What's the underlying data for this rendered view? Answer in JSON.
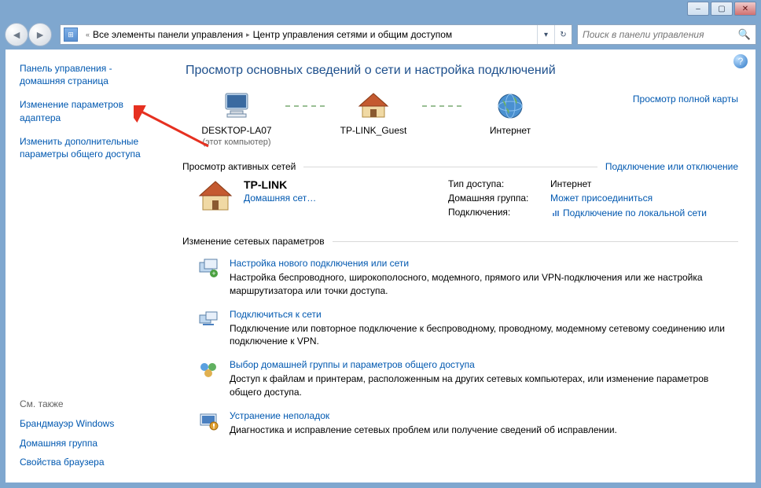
{
  "titlebar": {
    "minimize": "–",
    "maximize": "▢",
    "close": "✕"
  },
  "address": {
    "parent": "Все элементы панели управления",
    "current": "Центр управления сетями и общим доступом",
    "nav_back": "◄",
    "nav_fwd": "►",
    "refresh": "↻",
    "dropdown": "▾"
  },
  "search": {
    "placeholder": "Поиск в панели управления"
  },
  "sidebar": {
    "home": "Панель управления - домашняя страница",
    "adapter": "Изменение параметров адаптера",
    "sharing": "Изменить дополнительные параметры общего доступа",
    "see_also_label": "См. также",
    "links": {
      "firewall": "Брандмауэр Windows",
      "homegroup": "Домашняя группа",
      "browser": "Свойства браузера"
    }
  },
  "main": {
    "title": "Просмотр основных сведений о сети и настройка подключений",
    "map": {
      "view_map": "Просмотр полной карты",
      "computer_name": "DESKTOP-LA07",
      "computer_sub": "(этот компьютер)",
      "router_name": "TP-LINK_Guest",
      "internet_name": "Интернет"
    },
    "active_header": "Просмотр активных сетей",
    "active_link": "Подключение или отключение",
    "network": {
      "name": "TP-LINK",
      "type": "Домашняя сет…",
      "access_k": "Тип доступа:",
      "access_v": "Интернет",
      "homegroup_k": "Домашняя группа:",
      "homegroup_v": "Может присоединиться",
      "conn_k": "Подключения:",
      "conn_v": "Подключение по локальной сети"
    },
    "change_header": "Изменение сетевых параметров",
    "tasks": [
      {
        "title": "Настройка нового подключения или сети",
        "desc": "Настройка беспроводного, широкополосного, модемного, прямого или VPN-подключения или же настройка маршрутизатора или точки доступа."
      },
      {
        "title": "Подключиться к сети",
        "desc": "Подключение или повторное подключение к беспроводному, проводному, модемному сетевому соединению или подключение к VPN."
      },
      {
        "title": "Выбор домашней группы и параметров общего доступа",
        "desc": "Доступ к файлам и принтерам, расположенным на других сетевых компьютерах, или изменение параметров общего доступа."
      },
      {
        "title": "Устранение неполадок",
        "desc": "Диагностика и исправление сетевых проблем или получение сведений об исправлении."
      }
    ]
  }
}
